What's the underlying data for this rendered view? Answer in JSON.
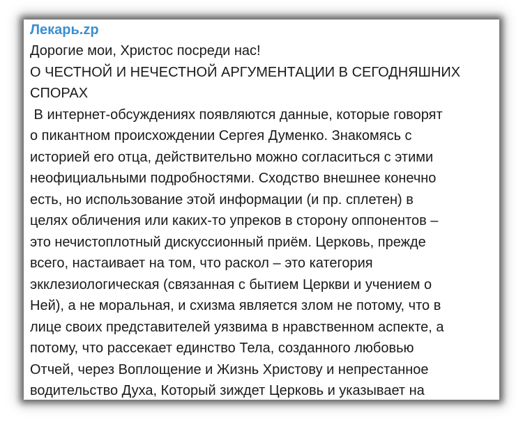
{
  "message": {
    "sender": "Лекарь.zp",
    "lines": [
      "Дорогие мои, Христос посреди нас!",
      "О ЧЕСТНОЙ И НЕЧЕСТНОЙ АРГУМЕНТАЦИИ В СЕГОДНЯШНИХ",
      "СПОРАХ",
      " В интернет-обсуждениях появляются данные, которые говорят",
      "о пикантном происхождении Сергея Думенко. Знакомясь с",
      "историей его отца, действительно можно согласиться с этими",
      "неофициальными подробностями. Сходство внешнее конечно",
      "есть, но использование этой информации (и пр. сплетен) в",
      "целях обличения или каких-то упреков в сторону оппонентов –",
      "это нечистоплотный дискуссионный приём. Церковь, прежде",
      "всего, настаивает на том, что раскол – это категория",
      "экклезиологическая (связанная с бытием Церкви и учением о",
      "Ней), а не моральная, и схизма является злом не потому, что в",
      "лице своих представителей уязвима в нравственном аспекте, а",
      "потому, что рассекает единство Тела, созданного любовью",
      "Отчей, через Воплощение и Жизнь Христову и непрестанное",
      "водительство Духа, Который зиждет Церковь и указывает на"
    ]
  },
  "colors": {
    "sender": "#3a8fd0",
    "text": "#1a1a1a",
    "background": "#ffffff"
  }
}
